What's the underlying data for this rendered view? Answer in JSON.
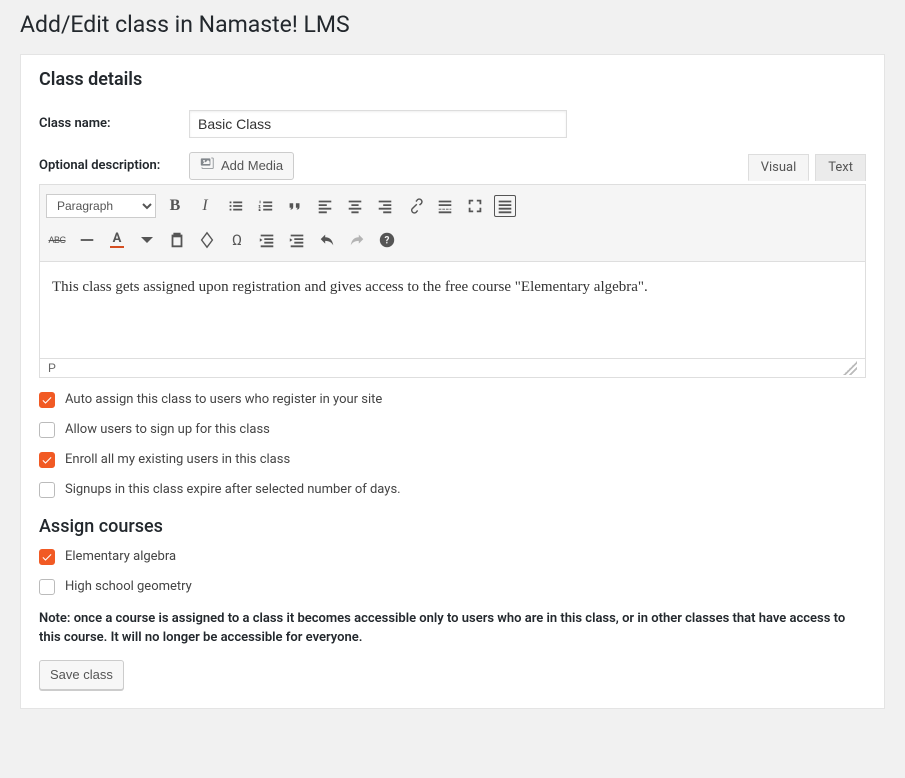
{
  "page": {
    "title": "Add/Edit class in Namaste! LMS"
  },
  "section_details_heading": "Class details",
  "form": {
    "class_name_label": "Class name:",
    "class_name_value": "Basic Class",
    "description_label": "Optional description:",
    "add_media_label": "Add Media"
  },
  "editor": {
    "tab_visual": "Visual",
    "tab_text": "Text",
    "format_select": "Paragraph",
    "content": "This class gets assigned upon registration and gives access to the free course \"Elementary algebra\".",
    "status_path": "P"
  },
  "options": [
    {
      "label": "Auto assign this class to users who register in your site",
      "checked": true
    },
    {
      "label": "Allow users to sign up for this class",
      "checked": false
    },
    {
      "label": "Enroll all my existing users in this class",
      "checked": true
    },
    {
      "label": "Signups in this class expire after selected number of days.",
      "checked": false
    }
  ],
  "assign_courses_heading": "Assign courses",
  "courses": [
    {
      "label": "Elementary algebra",
      "checked": true
    },
    {
      "label": "High school geometry",
      "checked": false
    }
  ],
  "note": "Note: once a course is assigned to a class it becomes accessible only to users who are in this class, or in other classes that have access to this course. It will no longer be accessible for everyone.",
  "save_button": "Save class"
}
